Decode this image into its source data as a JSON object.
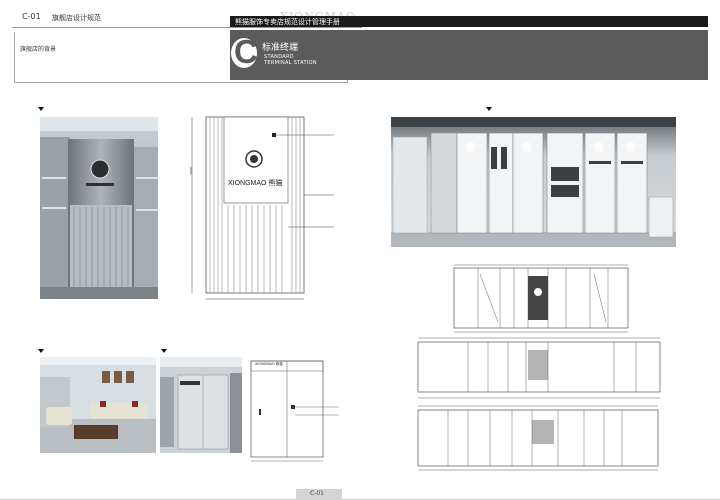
{
  "header": {
    "code": "C-01",
    "title": "旗舰店设计规范",
    "brand": "XIONGMAO",
    "manual_title": "熊猫服饰专卖店规范设计管理手册"
  },
  "section": {
    "letter": "C",
    "title_cn": "标准终端",
    "title_en_line1": "STANDARD",
    "title_en_line2": "TERMINAL STATION"
  },
  "left_panel": {
    "subtitle": "旗舰店的背景"
  },
  "drawing": {
    "logo_text": "XIONGMAO 熊猫"
  },
  "render": {
    "sign_1": "XIONGMAO 熊猫"
  },
  "footer": {
    "page": "C-01"
  },
  "colors": {
    "dark_bar": "#1a1a1a",
    "grey_band": "#5b5b5b"
  }
}
